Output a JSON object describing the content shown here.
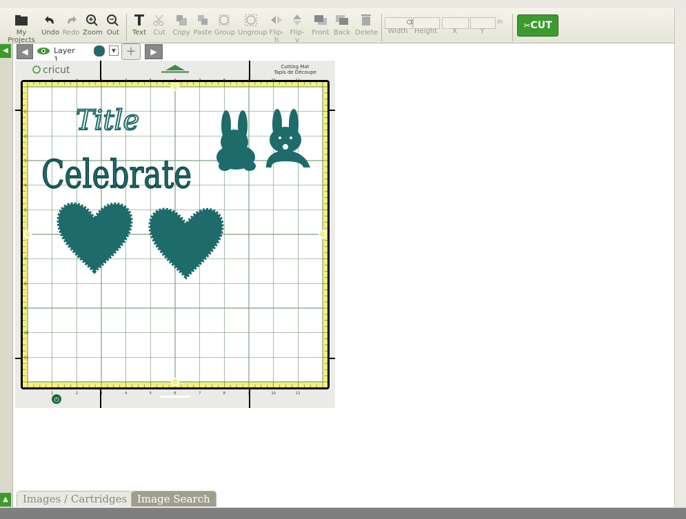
{
  "toolbar": {
    "my_projects": "My Projects",
    "undo": "Undo",
    "redo": "Redo",
    "zoom_in": "Zoom",
    "zoom_out": "Out",
    "text": "Text",
    "cut": "Cut",
    "copy": "Copy",
    "paste": "Paste",
    "group": "Group",
    "ungroup": "Ungroup",
    "flip_h": "Flip-h",
    "flip_v": "Flip-v",
    "front": "Front",
    "back": "Back",
    "delete": "Delete",
    "width_label": "Width",
    "height_label": "Height",
    "x_label": "X",
    "y_label": "Y",
    "unit": "in",
    "cut_button": "CUT"
  },
  "layer": {
    "name": "Layer 1",
    "color": "#1f6b6b"
  },
  "mat": {
    "brand": "cricut",
    "label_en": "Cutting Mat",
    "label_fr": "Tapis de Découpe",
    "top_ticks": [
      "1",
      "2",
      "3",
      "4",
      "5",
      "6",
      "7",
      "8",
      "9",
      "10",
      "11"
    ],
    "side_ticks": [
      "1",
      "2",
      "3",
      "4",
      "5",
      "6",
      "7",
      "8",
      "9",
      "10",
      "11"
    ]
  },
  "canvas": {
    "title_text": "Title",
    "celebrate_text": "Celebrate",
    "shape_color": "#1d6b6b"
  },
  "bottom_tabs": [
    "Images / Cartridges",
    "Image Search"
  ],
  "colors": {
    "accent_green": "#3d9a2e",
    "mat_grid": "#7f9f7f",
    "mat_border": "#f5f07a"
  }
}
